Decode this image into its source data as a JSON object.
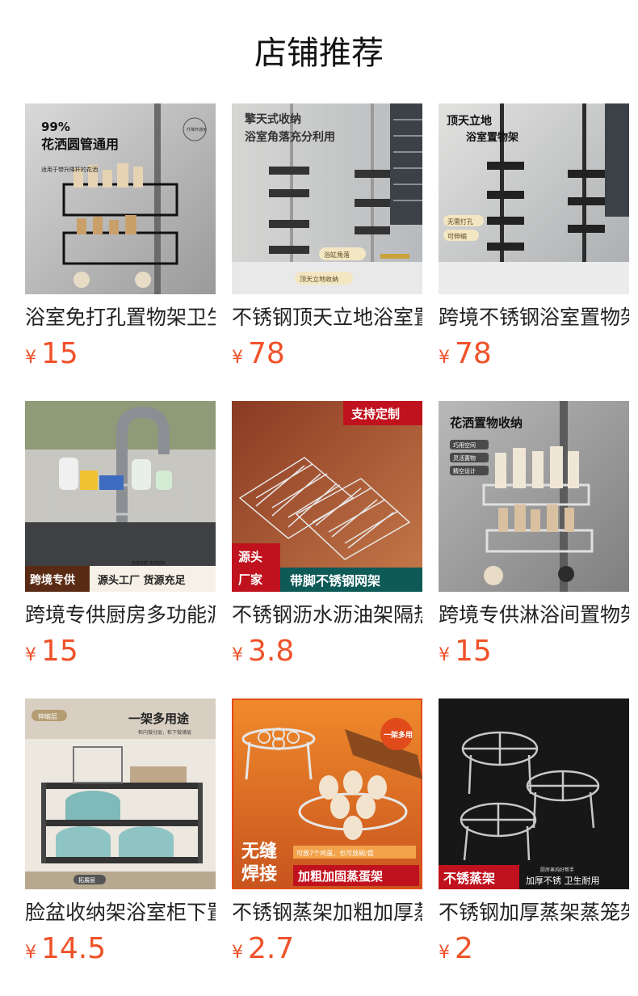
{
  "page": {
    "title": "店铺推荐"
  },
  "currency_symbol": "¥",
  "colors": {
    "price": "#f0522a",
    "title": "#111111",
    "name": "#222222"
  },
  "products": [
    {
      "name": "浴室免打孔置物架卫生间",
      "price": "15",
      "image_text": {
        "headline_1": "99%",
        "headline_2": "花洒圆管通用",
        "sub": "适用于带升降杆的花洒",
        "stamp": "升降杆通用"
      }
    },
    {
      "name": "不锈钢顶天立地浴室置物架",
      "price": "78",
      "image_text": {
        "headline_1": "擎天式收纳",
        "headline_2": "浴室角落充分利用",
        "tag_1": "浴缸角落",
        "tag_2": "顶天立地收纳"
      }
    },
    {
      "name": "跨境不锈钢浴室置物架",
      "price": "78",
      "image_text": {
        "headline_1": "顶天立地",
        "headline_2": "浴室置物架",
        "tag_1": "无需打孔",
        "tag_2": "可伸缩"
      }
    },
    {
      "name": "跨境专供厨房多功能沥水架",
      "price": "15",
      "image_text": {
        "banner_left": "跨境专供",
        "banner_small": "支持定制 支持贴标",
        "banner_right": "源头工厂 货源充足"
      }
    },
    {
      "name": "不锈钢沥水沥油架隔热架",
      "price": "3.8",
      "image_text": {
        "corner": "支持定制",
        "badge_1": "源头",
        "badge_2": "厂家",
        "banner": "带脚不锈钢网架"
      }
    },
    {
      "name": "跨境专供淋浴间置物架",
      "price": "15",
      "image_text": {
        "headline": "花洒置物收纳",
        "tag_1": "巧用空间",
        "tag_2": "灵活置物",
        "tag_3": "精空设计"
      }
    },
    {
      "name": "脸盆收纳架浴室柜下置物架",
      "price": "14.5",
      "image_text": {
        "tag_top": "伸缩层",
        "headline": "一架多用途",
        "sub": "柜内做分层，柜下做储层",
        "tag_bottom": "拓展层"
      }
    },
    {
      "name": "不锈钢蒸架加粗加厚蒸蛋架",
      "price": "2.7",
      "image_text": {
        "circle": "一架多用",
        "big_1": "无缝",
        "big_2": "焊接",
        "sub": "可放7个鸡蛋，也可放碗/盘",
        "banner": "加粗加固蒸蛋架"
      }
    },
    {
      "name": "不锈钢加厚蒸架蒸笼架",
      "price": "2",
      "image_text": {
        "banner": "不锈蒸架",
        "small": "厨房蒸炖好帮手",
        "right": "加厚不锈 卫生耐用"
      }
    }
  ]
}
